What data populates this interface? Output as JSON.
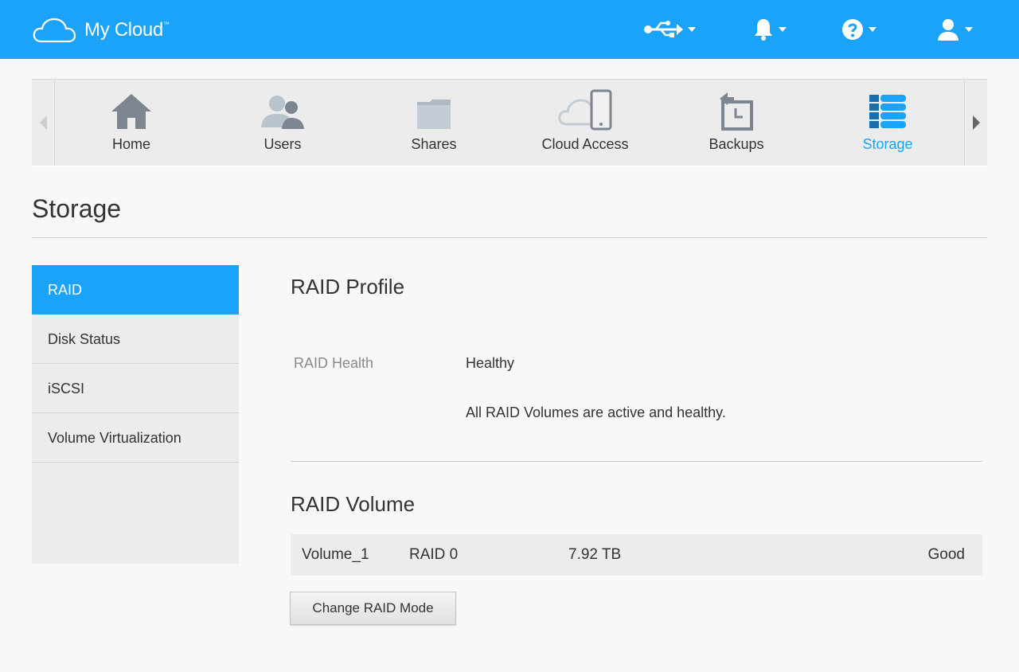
{
  "brand": {
    "name": "My Cloud",
    "tm": "™",
    "accent": "#1aa3f9"
  },
  "header": {
    "icons": [
      "usb-icon",
      "bell-icon",
      "help-icon",
      "user-icon"
    ]
  },
  "nav": {
    "items": [
      {
        "label": "Home",
        "icon": "home-icon"
      },
      {
        "label": "Users",
        "icon": "users-icon"
      },
      {
        "label": "Shares",
        "icon": "folder-icon"
      },
      {
        "label": "Cloud Access",
        "icon": "cloud-device-icon"
      },
      {
        "label": "Backups",
        "icon": "backup-icon"
      },
      {
        "label": "Storage",
        "icon": "storage-icon",
        "active": true
      }
    ]
  },
  "page": {
    "title": "Storage"
  },
  "sidebar": {
    "items": [
      {
        "label": "RAID",
        "active": true
      },
      {
        "label": "Disk Status"
      },
      {
        "label": "iSCSI"
      },
      {
        "label": "Volume Virtualization"
      }
    ]
  },
  "raid_profile": {
    "title": "RAID Profile",
    "health_label": "RAID Health",
    "health_value": "Healthy",
    "health_desc": "All RAID Volumes are active and healthy."
  },
  "raid_volume": {
    "title": "RAID Volume",
    "rows": [
      {
        "name": "Volume_1",
        "mode": "RAID 0",
        "size": "7.92 TB",
        "status": "Good"
      }
    ],
    "change_button": "Change RAID Mode"
  }
}
